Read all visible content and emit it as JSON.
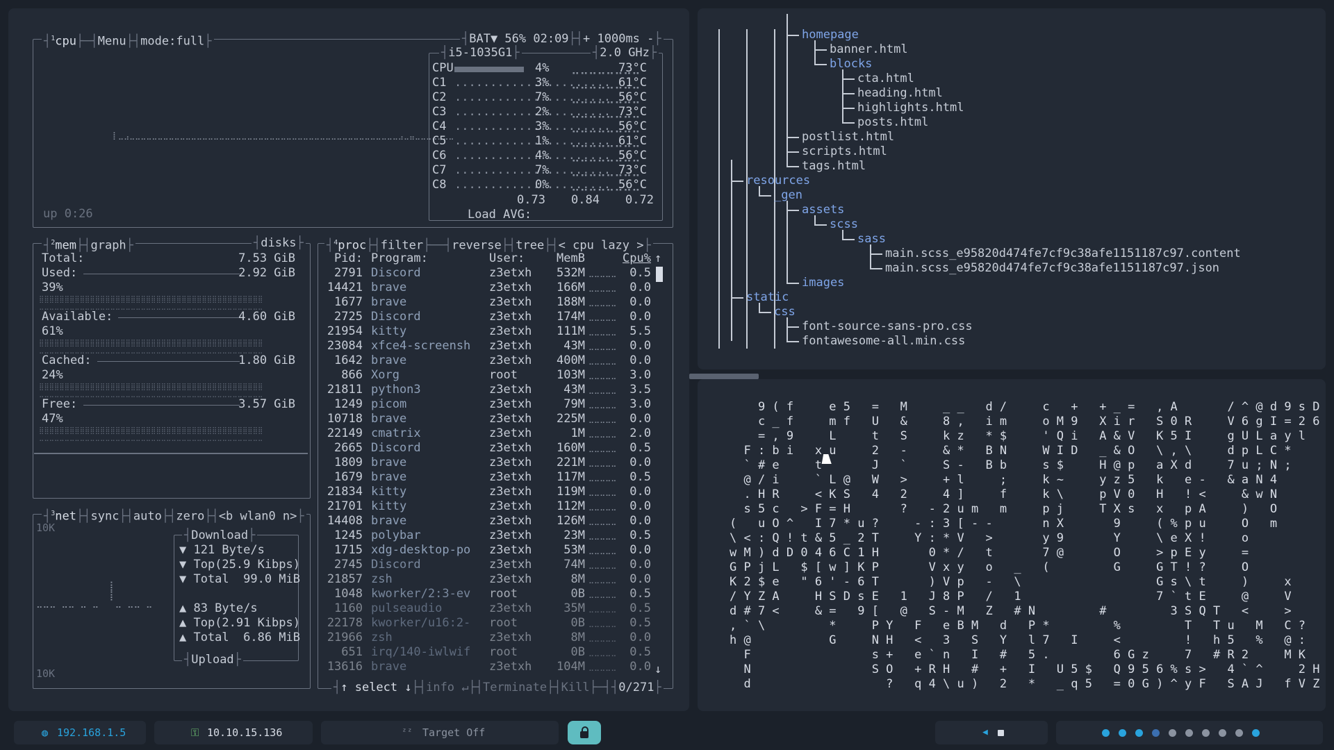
{
  "btop": {
    "cpu_box": {
      "num": "1",
      "label": "cpu",
      "menu": "Menu",
      "mode": "mode:full",
      "battery": "BAT▼ 56% 02:09",
      "interval": "+ 1000ms -",
      "uptime": "up 0:26"
    },
    "cpu_info": {
      "model": "i5-1035G1",
      "freq": "2.0 GHz",
      "rows": [
        {
          "name": "CPU",
          "pct": "4%",
          "temp": "73°C"
        },
        {
          "name": "C1",
          "pct": "3%",
          "temp": "61°C"
        },
        {
          "name": "C2",
          "pct": "7%",
          "temp": "56°C"
        },
        {
          "name": "C3",
          "pct": "2%",
          "temp": "73°C"
        },
        {
          "name": "C4",
          "pct": "3%",
          "temp": "56°C"
        },
        {
          "name": "C5",
          "pct": "1%",
          "temp": "61°C"
        },
        {
          "name": "C6",
          "pct": "4%",
          "temp": "56°C"
        },
        {
          "name": "C7",
          "pct": "7%",
          "temp": "73°C"
        },
        {
          "name": "C8",
          "pct": "0%",
          "temp": "56°C"
        }
      ],
      "load_label": "Load AVG:",
      "load": [
        "0.73",
        "0.84",
        "0.72"
      ]
    },
    "mem_box": {
      "num": "2",
      "label": "mem",
      "graph": "graph",
      "disks": "disks",
      "total_label": "Total:",
      "total": "7.53 GiB",
      "used_label": "Used:",
      "used": "2.92 GiB",
      "used_pct": "39%",
      "avail_label": "Available:",
      "avail": "4.60 GiB",
      "avail_pct": "61%",
      "cached_label": "Cached:",
      "cached": "1.80 GiB",
      "cached_pct": "24%",
      "free_label": "Free:",
      "free": "3.57 GiB",
      "free_pct": "47%"
    },
    "net_box": {
      "num": "3",
      "label": "net",
      "sync": "sync",
      "auto": "auto",
      "zero": "zero",
      "iface": "<b wlan0 n>",
      "scale_top": "10K",
      "scale_bottom": "10K",
      "download_title": "Download",
      "down_rate": "▼ 121 Byte/s",
      "down_top": "▼ Top(25.9 Kibps)",
      "down_total": "▼ Total  99.0 MiB",
      "up_rate": "▲ 83 Byte/s",
      "up_top": "▲ Top(2.91 Kibps)",
      "up_total": "▲ Total  6.86 MiB",
      "upload_title": "Upload"
    },
    "proc_box": {
      "num": "4",
      "label": "proc",
      "filter": "filter",
      "reverse": "reverse",
      "tree": "tree",
      "sort": "< cpu lazy >",
      "headers": {
        "pid": "Pid:",
        "program": "Program:",
        "user": "User:",
        "mem": "MemB",
        "cpu": "Cpu%"
      },
      "rows": [
        {
          "pid": "2791",
          "program": "Discord",
          "user": "z3etxh",
          "mem": "532M",
          "cpu": "0.5"
        },
        {
          "pid": "14421",
          "program": "brave",
          "user": "z3etxh",
          "mem": "166M",
          "cpu": "0.0"
        },
        {
          "pid": "1677",
          "program": "brave",
          "user": "z3etxh",
          "mem": "188M",
          "cpu": "0.0"
        },
        {
          "pid": "2725",
          "program": "Discord",
          "user": "z3etxh",
          "mem": "174M",
          "cpu": "0.0"
        },
        {
          "pid": "21954",
          "program": "kitty",
          "user": "z3etxh",
          "mem": "111M",
          "cpu": "5.5"
        },
        {
          "pid": "23084",
          "program": "xfce4-screensh",
          "user": "z3etxh",
          "mem": "43M",
          "cpu": "0.0"
        },
        {
          "pid": "1642",
          "program": "brave",
          "user": "z3etxh",
          "mem": "400M",
          "cpu": "0.0"
        },
        {
          "pid": "866",
          "program": "Xorg",
          "user": "root",
          "mem": "103M",
          "cpu": "3.0"
        },
        {
          "pid": "21811",
          "program": "python3",
          "user": "z3etxh",
          "mem": "43M",
          "cpu": "3.5"
        },
        {
          "pid": "1249",
          "program": "picom",
          "user": "z3etxh",
          "mem": "79M",
          "cpu": "3.0"
        },
        {
          "pid": "10718",
          "program": "brave",
          "user": "z3etxh",
          "mem": "225M",
          "cpu": "0.0"
        },
        {
          "pid": "22149",
          "program": "cmatrix",
          "user": "z3etxh",
          "mem": "1M",
          "cpu": "2.0"
        },
        {
          "pid": "2665",
          "program": "Discord",
          "user": "z3etxh",
          "mem": "160M",
          "cpu": "0.5"
        },
        {
          "pid": "1809",
          "program": "brave",
          "user": "z3etxh",
          "mem": "221M",
          "cpu": "0.0"
        },
        {
          "pid": "1679",
          "program": "brave",
          "user": "z3etxh",
          "mem": "117M",
          "cpu": "0.5"
        },
        {
          "pid": "21834",
          "program": "kitty",
          "user": "z3etxh",
          "mem": "119M",
          "cpu": "0.0"
        },
        {
          "pid": "21701",
          "program": "kitty",
          "user": "z3etxh",
          "mem": "112M",
          "cpu": "0.0"
        },
        {
          "pid": "14408",
          "program": "brave",
          "user": "z3etxh",
          "mem": "126M",
          "cpu": "0.0"
        },
        {
          "pid": "1245",
          "program": "polybar",
          "user": "z3etxh",
          "mem": "23M",
          "cpu": "0.5"
        },
        {
          "pid": "1715",
          "program": "xdg-desktop-po",
          "user": "z3etxh",
          "mem": "53M",
          "cpu": "0.0"
        },
        {
          "pid": "2745",
          "program": "Discord",
          "user": "z3etxh",
          "mem": "74M",
          "cpu": "0.0"
        },
        {
          "pid": "21857",
          "program": "zsh",
          "user": "z3etxh",
          "mem": "8M",
          "cpu": "0.0"
        },
        {
          "pid": "1048",
          "program": "kworker/2:3-ev",
          "user": "root",
          "mem": "0B",
          "cpu": "0.5"
        },
        {
          "pid": "1160",
          "program": "pulseaudio",
          "user": "z3etxh",
          "mem": "35M",
          "cpu": "0.5"
        },
        {
          "pid": "22178",
          "program": "kworker/u16:2-",
          "user": "root",
          "mem": "0B",
          "cpu": "0.5"
        },
        {
          "pid": "21966",
          "program": "zsh",
          "user": "z3etxh",
          "mem": "8M",
          "cpu": "0.0"
        },
        {
          "pid": "651",
          "program": "irq/140-iwlwif",
          "user": "root",
          "mem": "0B",
          "cpu": "0.5"
        },
        {
          "pid": "13616",
          "program": "brave",
          "user": "z3etxh",
          "mem": "104M",
          "cpu": "0.0"
        }
      ],
      "footer": {
        "select": "↑ select ↓",
        "info": "info ↵",
        "terminate": "Terminate",
        "kill": "Kill",
        "count": "0/271"
      }
    }
  },
  "tree": [
    {
      "depth": 4,
      "name": "homepage",
      "dir": true
    },
    {
      "depth": 5,
      "name": "banner.html",
      "dir": false
    },
    {
      "depth": 5,
      "name": "blocks",
      "dir": true
    },
    {
      "depth": 6,
      "name": "cta.html",
      "dir": false
    },
    {
      "depth": 6,
      "name": "heading.html",
      "dir": false
    },
    {
      "depth": 6,
      "name": "highlights.html",
      "dir": false
    },
    {
      "depth": 6,
      "name": "posts.html",
      "dir": false
    },
    {
      "depth": 4,
      "name": "postlist.html",
      "dir": false
    },
    {
      "depth": 4,
      "name": "scripts.html",
      "dir": false
    },
    {
      "depth": 4,
      "name": "tags.html",
      "dir": false
    },
    {
      "depth": 2,
      "name": "resources",
      "dir": true
    },
    {
      "depth": 3,
      "name": "_gen",
      "dir": true
    },
    {
      "depth": 4,
      "name": "assets",
      "dir": true
    },
    {
      "depth": 5,
      "name": "scss",
      "dir": true
    },
    {
      "depth": 6,
      "name": "sass",
      "dir": true
    },
    {
      "depth": 7,
      "name": "main.scss_e95820d474fe7cf9c38afe1151187c97.content",
      "dir": false
    },
    {
      "depth": 7,
      "name": "main.scss_e95820d474fe7cf9c38afe1151187c97.json",
      "dir": false
    },
    {
      "depth": 4,
      "name": "images",
      "dir": true
    },
    {
      "depth": 2,
      "name": "static",
      "dir": true
    },
    {
      "depth": 3,
      "name": "css",
      "dir": true
    },
    {
      "depth": 4,
      "name": "font-source-sans-pro.css",
      "dir": false
    },
    {
      "depth": 4,
      "name": "fontawesome-all.min.css",
      "dir": false
    }
  ],
  "matrix_lines": [
    "    9 ( f     e 5   =   M     _ _   d /     c   +   + _ =   , A       / ^ @ d 9 s D",
    "    c _ f     m f   U   &     8 ,   i m     o M 9   X i r   S 0 R     V 6 g I = 2 6",
    "    = , 9     L     t   S     k z   * $     ' Q i   A & V   K 5 I     g U L a y l",
    "  F : b i   x u     2   -     & *   B N     W I D   _ & O   \\ , \\     d p L C *",
    "  ` # e     t       J   `     S -   B b     s $     H @ p   a X d     7 u ; N ;",
    "  @ / i     ` L @   W   >     + l     ;     k ~     y z 5   k   e -   & a N 4",
    "  . H R     < K S   4   2     4 ]     f     k \\     p V 0   H   ! <     & w N",
    "  s 5 c   > F = H       ?   - 2 u m   m     p j     T X s   x   p A     )   O",
    "(   u O ^   I 7 * u ?     - : 3 [ - -       n X       9     ( % p u     O   m",
    "\\ < : Q ! t & 5 _ 2 T     Y : * V   >       y 9       Y     \\ e X !     o",
    "w M ) d D 0 4 6 C 1 H       0 * /   t       7 @       O     > p E y     =",
    "G P j L   $ [ w ] K P       V x y   o   _   (         G     G T ! ?     O",
    "K 2 $ e   \" 6 ' - 6 T       ) V p   -   \\                   G s \\ t     )     x",
    "/ Y Z A     H S D s E   1   J 8 P   /   1                   7 ` t E     @     V",
    "d # 7 <     & =   9 [   @   S - M   Z   # N         #         3 S Q T   <     >",
    ", ` \\         *     P Y   F   e B M   d   P *         %         T   T u   M   C ?",
    "h @           G     N H   <   3   S   Y   l 7   I     <         !   h 5   %   @ :",
    "  F                 s +   e ` n   I   #   5 .         6 G z     7   # R 2     M K",
    "  N                 S O   + R H   #   +   I   U 5 $   Q 9 5 6 % s >   4 ` ^     2 H",
    "  d                   ?   q 4 \\ u )   2   *   _ q 5   = 0 G ) ^ y F   S A J   f V Z"
  ],
  "statusbar": {
    "ip_local": "192.168.1.5",
    "ip_vpn": "10.10.15.136",
    "target": "Target Off",
    "dots": [
      "#29a3dd",
      "#29a3dd",
      "#29a3dd",
      "#3b6fb0",
      "#8b93a0",
      "#8b93a0",
      "#8b93a0",
      "#8b93a0",
      "#8b93a0",
      "#29a3dd"
    ]
  },
  "colors": {
    "accent": "#29a3dd",
    "folder": "#7fa5e8",
    "lock_btn": "#5fbcc0"
  }
}
